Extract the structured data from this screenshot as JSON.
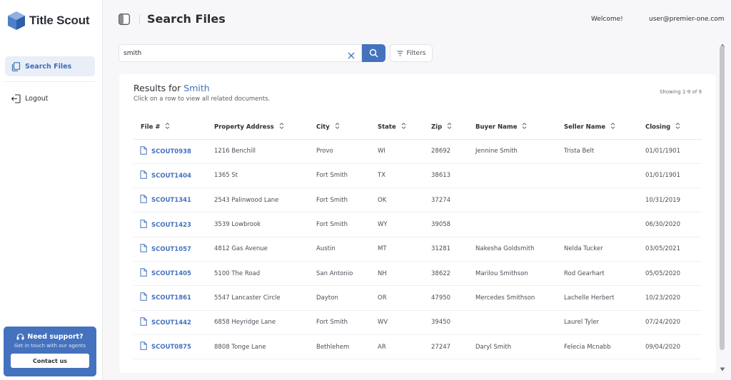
{
  "app": {
    "name": "Title Scout"
  },
  "sidebar": {
    "items": [
      {
        "label": "Search Files",
        "icon": "copy-files-icon",
        "active": true
      },
      {
        "label": "Logout",
        "icon": "logout-icon",
        "active": false
      }
    ],
    "support": {
      "title": "Need support?",
      "subtitle": "Get in touch with our agents",
      "button_label": "Contact us"
    }
  },
  "header": {
    "title": "Search Files",
    "welcome": "Welcome!",
    "user_email": "user@premier-one.com"
  },
  "search": {
    "value": "smith",
    "filters_label": "Filters"
  },
  "results": {
    "title_prefix": "Results for ",
    "term": "Smith",
    "subtitle": "Click on a row to view all related documents.",
    "showing": "Showing 1-9 of 9",
    "columns": [
      "File #",
      "Property Address",
      "City",
      "State",
      "Zip",
      "Buyer Name",
      "Seller Name",
      "Closing"
    ],
    "rows": [
      [
        "SCOUT0938",
        "1216 Benchill",
        "Provo",
        "WI",
        "28692",
        "Jennine Smith",
        "Trista Belt",
        "01/01/1901"
      ],
      [
        "SCOUT1404",
        "1365 St",
        "Fort Smith",
        "TX",
        "38613",
        "",
        "",
        "01/01/1901"
      ],
      [
        "SCOUT1341",
        "2543 Palinwood Lane",
        "Fort Smith",
        "OK",
        "37274",
        "",
        "",
        "10/31/2019"
      ],
      [
        "SCOUT1423",
        "3539 Lowbrook",
        "Fort Smith",
        "WY",
        "39058",
        "",
        "",
        "06/30/2020"
      ],
      [
        "SCOUT1057",
        "4812 Gas Avenue",
        "Austin",
        "MT",
        "31281",
        "Nakesha Goldsmith",
        "Nelda Tucker",
        "03/05/2021"
      ],
      [
        "SCOUT1405",
        "5100 The Road",
        "San Antonio",
        "NH",
        "38622",
        "Marilou Smithson",
        "Rod Gearhart",
        "05/05/2020"
      ],
      [
        "SCOUT1861",
        "5547 Lancaster Circle",
        "Dayton",
        "OR",
        "47950",
        "Mercedes Smithson",
        "Lachelle Herbert",
        "10/23/2020"
      ],
      [
        "SCOUT1442",
        "6858 Heyridge Lane",
        "Fort Smith",
        "WV",
        "39450",
        "",
        "Laurel Tyler",
        "07/24/2020"
      ],
      [
        "SCOUT0875",
        "8808 Tonge Lane",
        "Bethlehem",
        "AR",
        "27247",
        "Daryl Smith",
        "Felecia Mcnabb",
        "09/04/2020"
      ]
    ]
  },
  "colors": {
    "accent": "#4472be",
    "active_bg": "#e9eef7"
  }
}
